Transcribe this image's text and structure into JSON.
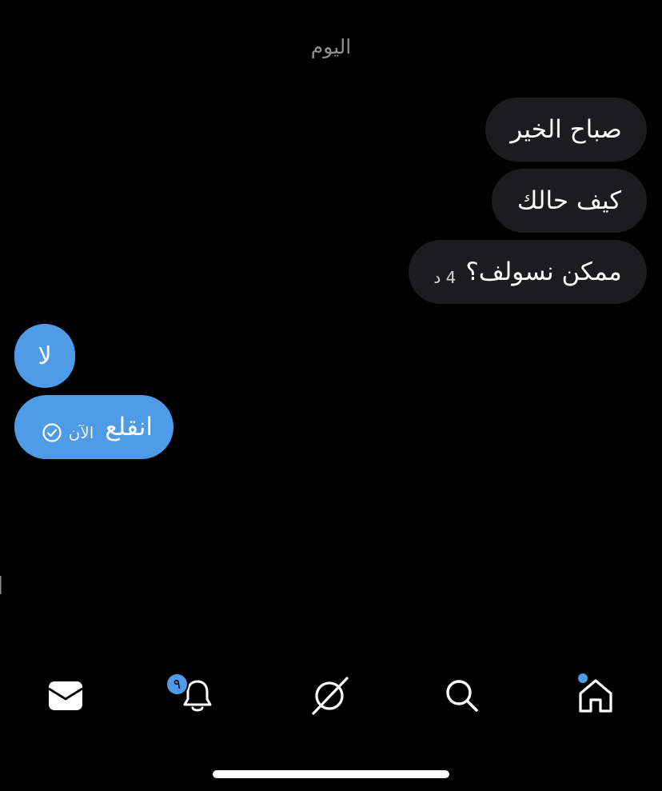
{
  "conversation": {
    "day_separator": "اليوم",
    "incoming": [
      {
        "text": "صباح الخير"
      },
      {
        "text": "كيف حالك"
      },
      {
        "text": "ممكن نسولف؟",
        "time": "4 د"
      }
    ],
    "outgoing": [
      {
        "text": "لا"
      },
      {
        "text": "انقلع",
        "time": "الآن"
      }
    ],
    "partial_text": "ا"
  },
  "bottom_nav": {
    "items": [
      {
        "icon": "mail-icon"
      },
      {
        "icon": "bell-icon",
        "badge": "٩"
      },
      {
        "icon": "spaces-icon"
      },
      {
        "icon": "search-icon"
      },
      {
        "icon": "home-icon"
      }
    ]
  },
  "colors": {
    "background": "#000000",
    "incoming_bubble": "#1c1c1e",
    "outgoing_bubble": "#4f9be8",
    "muted_text": "#8e8e93"
  }
}
